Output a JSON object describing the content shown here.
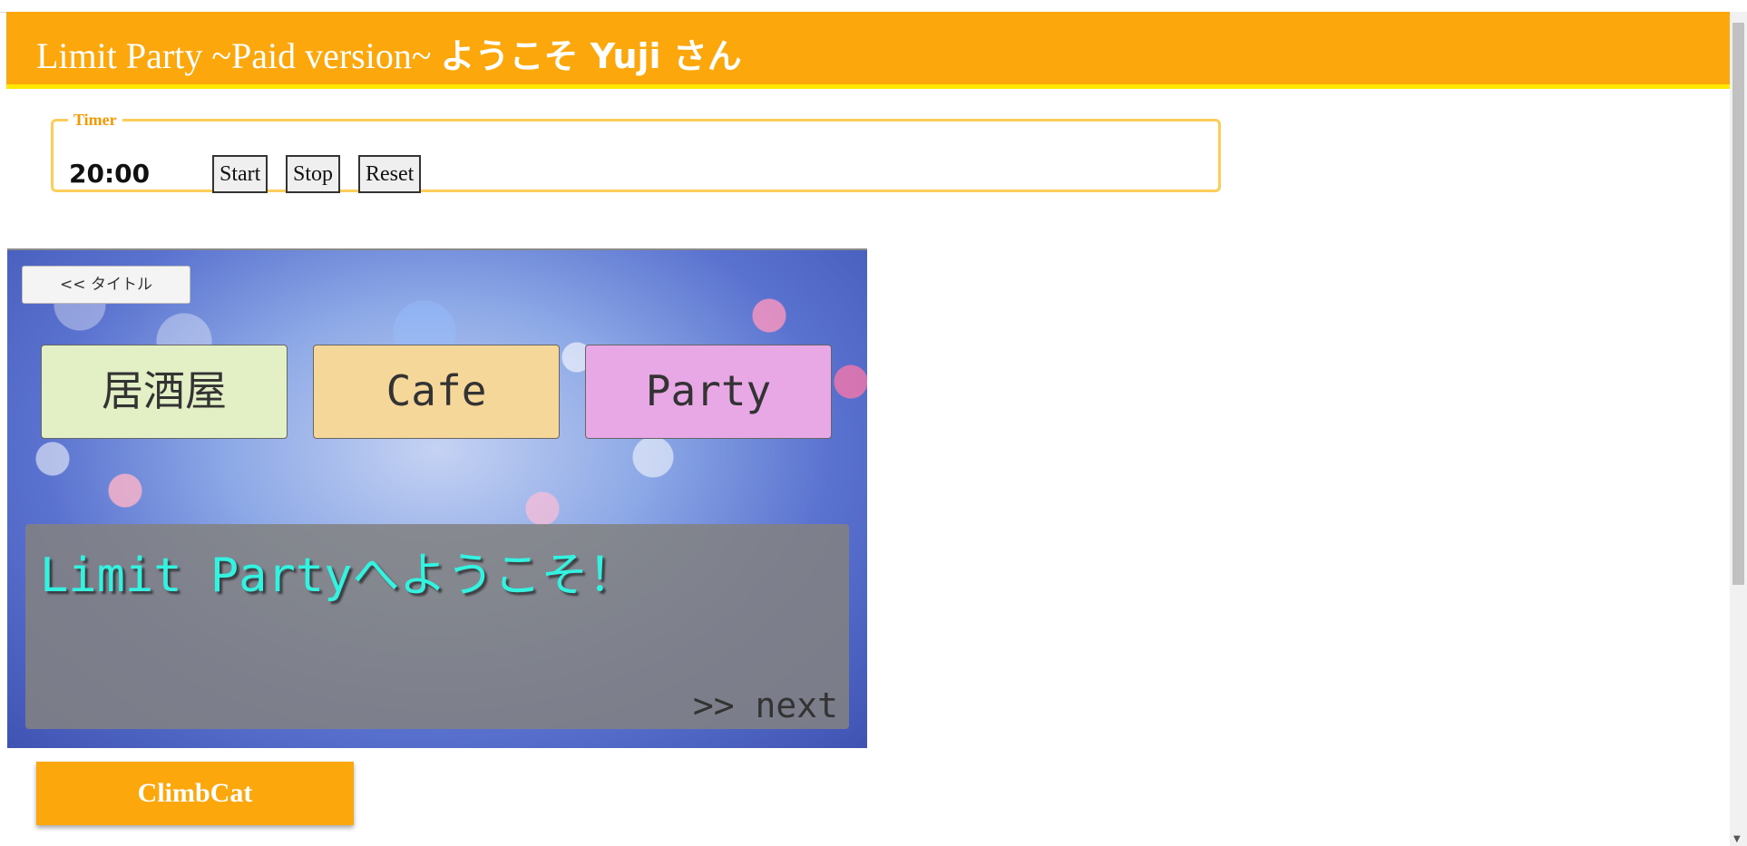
{
  "header": {
    "title": "Limit Party ~Paid version~ ",
    "welcome": "ようこそ Yuji さん"
  },
  "timer": {
    "legend": "Timer",
    "time": "20:00",
    "start_label": "Start",
    "stop_label": "Stop",
    "reset_label": "Reset"
  },
  "game": {
    "back_label": "<< タイトル",
    "categories": [
      {
        "label": "居酒屋",
        "color": "#e3efc4"
      },
      {
        "label": "Cafe",
        "color": "#f6d79a"
      },
      {
        "label": "Party",
        "color": "#e8a8e6"
      }
    ],
    "message": "Limit Partyへようこそ！",
    "next_label": ">> next"
  },
  "climb_label": "ClimbCat",
  "colors": {
    "accent": "#fca80c",
    "header_underline": "#ffe800",
    "message_text": "#34f2e0"
  }
}
